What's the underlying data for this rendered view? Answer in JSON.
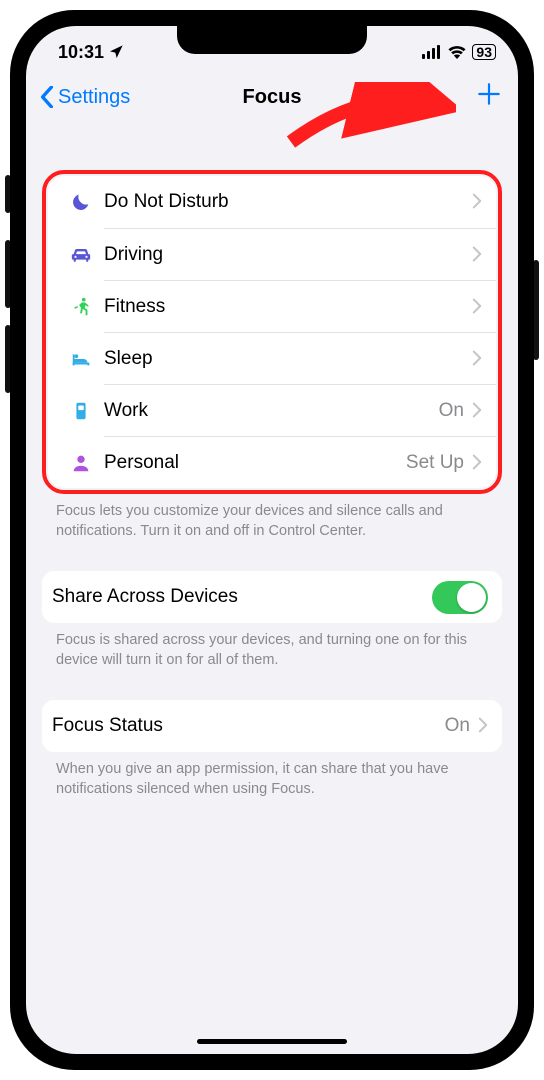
{
  "status": {
    "time": "10:31",
    "battery": "93"
  },
  "nav": {
    "back_label": "Settings",
    "title": "Focus"
  },
  "focus_modes": [
    {
      "label": "Do Not Disturb",
      "icon": "moon",
      "color": "#5856d6",
      "detail": ""
    },
    {
      "label": "Driving",
      "icon": "car",
      "color": "#5856d6",
      "detail": ""
    },
    {
      "label": "Fitness",
      "icon": "runner",
      "color": "#30d158",
      "detail": ""
    },
    {
      "label": "Sleep",
      "icon": "bed",
      "color": "#32ade6",
      "detail": ""
    },
    {
      "label": "Work",
      "icon": "badge",
      "color": "#32ade6",
      "detail": "On"
    },
    {
      "label": "Personal",
      "icon": "person",
      "color": "#af52de",
      "detail": "Set Up"
    }
  ],
  "focus_footer": "Focus lets you customize your devices and silence calls and notifications. Turn it on and off in Control Center.",
  "share": {
    "label": "Share Across Devices",
    "on": true,
    "footer": "Focus is shared across your devices, and turning one on for this device will turn it on for all of them."
  },
  "focus_status": {
    "label": "Focus Status",
    "detail": "On",
    "footer": "When you give an app permission, it can share that you have notifications silenced when using Focus."
  }
}
